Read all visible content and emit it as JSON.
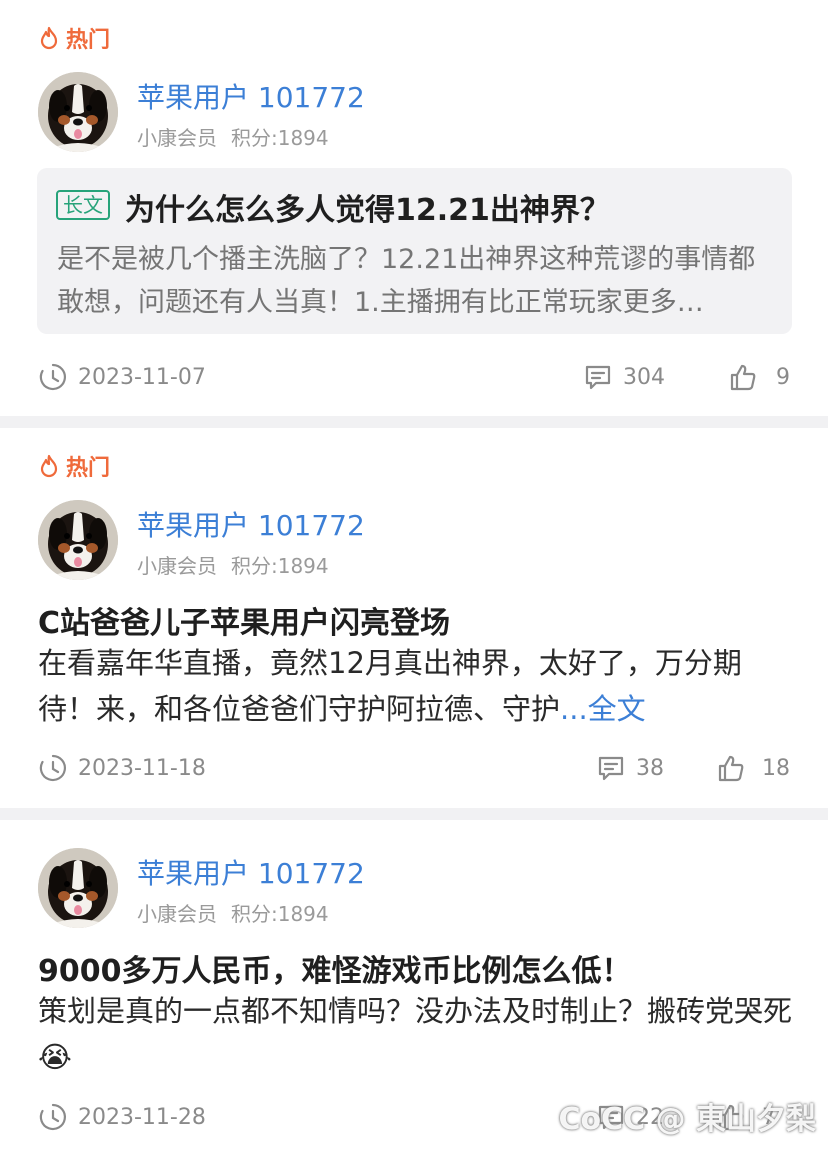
{
  "posts": [
    {
      "hot_label": "热门",
      "username": "苹果用户 101772",
      "member_level": "小康会员",
      "points": "积分:1894",
      "badge": "长文",
      "title": "为什么怎么多人觉得12.21出神界？",
      "excerpt": "是不是被几个播主洗脑了？12.21出神界这种荒谬的事情都敢想，问题还有人当真！1.主播拥有比正常玩家更多…",
      "date": "2023-11-07",
      "comments": "304",
      "likes": "9"
    },
    {
      "hot_label": "热门",
      "username": "苹果用户 101772",
      "member_level": "小康会员",
      "points": "积分:1894",
      "title": "C站爸爸儿子苹果用户闪亮登场",
      "body": "在看嘉年华直播，竟然12月真出神界，太好了，万分期待！来，和各位爸爸们守护阿拉德、守护",
      "more_link": "...全文",
      "date": "2023-11-18",
      "comments": "38",
      "likes": "18"
    },
    {
      "username": "苹果用户 101772",
      "member_level": "小康会员",
      "points": "积分:1894",
      "title": "9000多万人民币，难怪游戏币比例怎么低！",
      "body": "策划是真的一点都不知情吗？没办法及时制止？搬砖党哭死😭",
      "date": "2023-11-28",
      "comments": "22",
      "likes": "7"
    }
  ],
  "watermark": "CoCC @ 東山夕梨",
  "icons": {
    "hot": "flame-icon",
    "date": "clock-icon",
    "comments": "comment-icon",
    "likes": "thumbs-up-icon"
  },
  "colors": {
    "hot": "#ef6a3b",
    "username": "#3c7fd6",
    "badge": "#27a37a",
    "meta": "#9a9a9a"
  }
}
